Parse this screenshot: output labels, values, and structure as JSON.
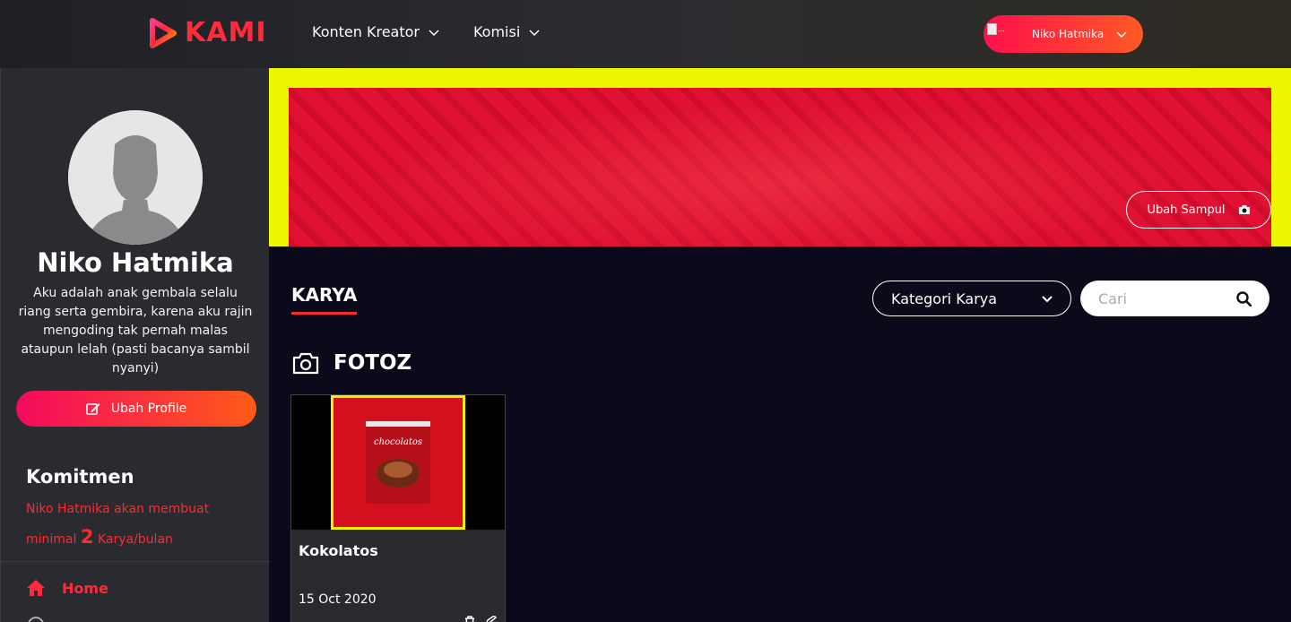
{
  "brand": {
    "name": "KAMI",
    "accent": "#ff2c3b"
  },
  "nav": {
    "items": [
      {
        "label": "Konten Kreator"
      },
      {
        "label": "Komisi"
      }
    ]
  },
  "user_menu": {
    "name": "Niko Hatmika",
    "avatar_alt": "..."
  },
  "profile": {
    "name": "Niko Hatmika",
    "bio": "Aku adalah anak gembala selalu riang serta gembira, karena aku rajin mengoding tak pernah malas ataupun lelah (pasti bacanya sambil nyanyi)",
    "edit_label": "Ubah Profile"
  },
  "commitment": {
    "title": "Komitmen",
    "text_before": "Niko Hatmika akan membuat minimal",
    "count": "2",
    "text_after": "Karya/bulan"
  },
  "sidebar_menu": {
    "home_label": "Home"
  },
  "cover": {
    "change_label": "Ubah Sampul"
  },
  "karya": {
    "tab_label": "KARYA",
    "category_label": "Kategori Karya",
    "search_placeholder": "Cari",
    "section_title": "FOTOZ"
  },
  "cards": [
    {
      "title": "Kokolatos",
      "date": "15 Oct 2020",
      "thumb_text": "chocolatos"
    }
  ]
}
